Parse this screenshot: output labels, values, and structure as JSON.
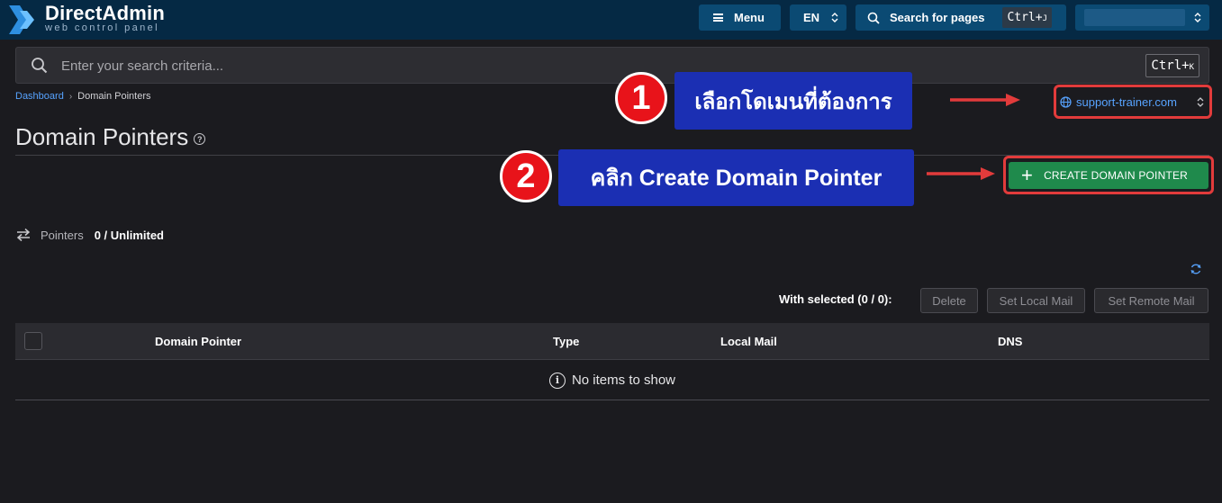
{
  "header": {
    "brand_name": "DirectAdmin",
    "brand_tagline": "web control panel",
    "menu_label": "Menu",
    "language": "EN",
    "search_pages_label": "Search for pages",
    "search_pages_shortcut_mod": "Ctrl+",
    "search_pages_shortcut_key": "J"
  },
  "global_search": {
    "placeholder": "Enter your search criteria...",
    "shortcut_mod": "Ctrl+",
    "shortcut_key": "K"
  },
  "breadcrumb": {
    "root": "Dashboard",
    "current": "Domain Pointers"
  },
  "domain_selector": {
    "value": "support-trainer.com"
  },
  "page": {
    "title": "Domain Pointers",
    "help": "?"
  },
  "actions": {
    "create_label": "CREATE DOMAIN POINTER"
  },
  "annotations": {
    "step1_number": "1",
    "step1_text": "เลือกโดเมนที่ต้องการ",
    "step2_number": "2",
    "step2_text": "คลิก Create Domain Pointer"
  },
  "stats": {
    "label": "Pointers",
    "value": "0 / Unlimited"
  },
  "bulk": {
    "with_selected": "With selected (0 / 0):",
    "delete": "Delete",
    "set_local_mail": "Set Local Mail",
    "set_remote_mail": "Set Remote Mail"
  },
  "table": {
    "columns": [
      "Domain Pointer",
      "Type",
      "Local Mail",
      "DNS"
    ],
    "empty_text": "No items to show",
    "info": "i"
  },
  "colors": {
    "topbar": "#052944",
    "accent_blue": "#57a3ff",
    "create_green": "#1f8a4c",
    "annotation_red": "#e23b3b",
    "callout_blue": "#1b2fb3"
  }
}
